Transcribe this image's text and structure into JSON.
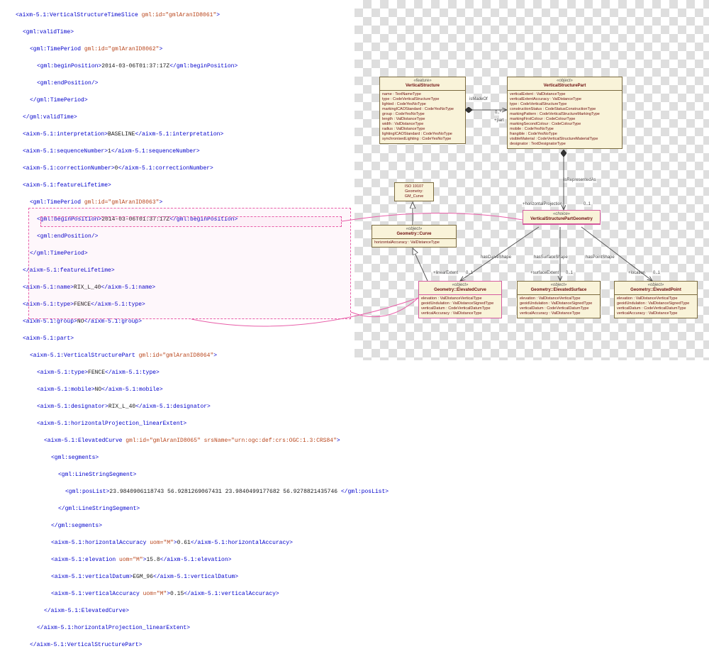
{
  "xml": {
    "l0": "<aixm-5.1:VerticalStructureTimeSlice ",
    "l0_attr": "gml:id=\"gmlAranID8061\"",
    "l0_end": ">",
    "l1": "<gml:validTime>",
    "l2": "<gml:TimePeriod ",
    "l2_attr": "gml:id=\"gmlAranID8062\"",
    "l2_end": ">",
    "l3": "<gml:beginPosition>",
    "l3_txt": "2014-03-06T01:37:17Z",
    "l3_end": "</gml:beginPosition>",
    "l4": "<gml:endPosition/>",
    "l5": "</gml:TimePeriod>",
    "l6": "</gml:validTime>",
    "l7": "<aixm-5.1:interpretation>",
    "l7_txt": "BASELINE",
    "l7_end": "</aixm-5.1:interpretation>",
    "l8": "<aixm-5.1:sequenceNumber>",
    "l8_txt": "1",
    "l8_end": "</aixm-5.1:sequenceNumber>",
    "l9": "<aixm-5.1:correctionNumber>",
    "l9_txt": "0",
    "l9_end": "</aixm-5.1:correctionNumber>",
    "l10": "<aixm-5.1:featureLifetime>",
    "l11": "<gml:TimePeriod ",
    "l11_attr": "gml:id=\"gmlAranID8063\"",
    "l11_end": ">",
    "l12": "<gml:beginPosition>",
    "l12_txt": "2014-03-06T01:37:17Z",
    "l12_end": "</gml:beginPosition>",
    "l13": "<gml:endPosition/>",
    "l14": "</gml:TimePeriod>",
    "l15": "</aixm-5.1:featureLifetime>",
    "l16": "<aixm-5.1:name>",
    "l16_txt": "RIX_L_40",
    "l16_end": "</aixm-5.1:name>",
    "l17": "<aixm-5.1:type>",
    "l17_txt": "FENCE",
    "l17_end": "</aixm-5.1:type>",
    "l18": "<aixm-5.1:group>",
    "l18_txt": "NO",
    "l18_end": "</aixm-5.1:group>",
    "l19": "<aixm-5.1:part>",
    "l20": "<aixm-5.1:VerticalStructurePart ",
    "l20_attr": "gml:id=\"gmlAranID8064\"",
    "l20_end": ">",
    "l21": "<aixm-5.1:type>",
    "l21_txt": "FENCE",
    "l21_end": "</aixm-5.1:type>",
    "l22": "<aixm-5.1:mobile>",
    "l22_txt": "NO",
    "l22_end": "</aixm-5.1:mobile>",
    "l23": "<aixm-5.1:designator>",
    "l23_txt": "RIX_L_40",
    "l23_end": "</aixm-5.1:designator>",
    "l24": "<aixm-5.1:horizontalProjection_linearExtent>",
    "l25": "<aixm-5.1:ElevatedCurve ",
    "l25_attr1": "gml:id=\"gmlAranID8065\"",
    "l25_attr2": " srsName=\"urn:ogc:def:crs:OGC:1.3:CRS84\"",
    "l25_end": ">",
    "l26": "<gml:segments>",
    "l27": "<gml:LineStringSegment>",
    "l28": "<gml:posList>",
    "l28_txt": "23.9840906118743 56.9281269067431 23.9840499177682 56.9278821435746 ",
    "l28_end": "</gml:posList>",
    "l29": "</gml:LineStringSegment>",
    "l30": "</gml:segments>",
    "l31": "<aixm-5.1:horizontalAccuracy ",
    "l31_attr": "uom=\"M\"",
    "l31_mid": ">",
    "l31_txt": "0.61",
    "l31_end": "</aixm-5.1:horizontalAccuracy>",
    "l32": "<aixm-5.1:elevation ",
    "l32_attr": "uom=\"M\"",
    "l32_mid": ">",
    "l32_txt": "15.8",
    "l32_end": "</aixm-5.1:elevation>",
    "l33": "<aixm-5.1:verticalDatum>",
    "l33_txt": "EGM_96",
    "l33_end": "</aixm-5.1:verticalDatum>",
    "l34": "<aixm-5.1:verticalAccuracy ",
    "l34_attr": "uom=\"M\"",
    "l34_mid": ">",
    "l34_txt": "0.15",
    "l34_end": "</aixm-5.1:verticalAccuracy>",
    "l35": "</aixm-5.1:ElevatedCurve>",
    "l36": "</aixm-5.1:horizontalProjection_linearExtent>",
    "l37": "</aixm-5.1:VerticalStructurePart>"
  },
  "uml": {
    "vs": {
      "stereo": "«feature»",
      "title": "VerticalStructure",
      "attrs": [
        "name : TextNameType",
        "type : CodeVerticalStructureType",
        "lighted : CodeYesNoType",
        "markingICAOStandard : CodeYesNoType",
        "group : CodeYesNoType",
        "length : ValDistanceType",
        "width : ValDistanceType",
        "radius : ValDistanceType",
        "lightingICAOStandard : CodeYesNoType",
        "synchronisedLighting : CodeYesNoType"
      ]
    },
    "vsp": {
      "stereo": "«object»",
      "title": "VerticalStructurePart",
      "attrs": [
        "verticalExtent : ValDistanceType",
        "verticalExtentAccuracy : ValDistanceType",
        "type : CodeVerticalStructureType",
        "constructionStatus : CodeStatusConstructionType",
        "markingPattern : CodeVerticalStructureMarkingType",
        "markingFirstColour : CodeColourType",
        "markingSecondColour : CodeColourType",
        "mobile : CodeYesNoType",
        "frangible : CodeYesNoType",
        "visibleMaterial : CodeVerticalStructureMaterialType",
        "designator : TextDesignatorType"
      ]
    },
    "iso": {
      "title": "ISO 19107 Geometry: GM_Curve"
    },
    "gcurve": {
      "stereo": "«object»",
      "title": "Geometry::Curve",
      "attrs": [
        "horizontalAccuracy : ValDistanceType"
      ]
    },
    "vspg": {
      "stereo": "«choice»",
      "title": "VerticalStructurePartGeometry"
    },
    "ecurve": {
      "stereo": "«object»",
      "title": "Geometry::ElevatedCurve",
      "attrs": [
        "elevation : ValDistanceVerticalType",
        "geoidUndulation : ValDistanceSignedType",
        "verticalDatum : CodeVerticalDatumType",
        "verticalAccuracy : ValDistanceType"
      ]
    },
    "esurf": {
      "stereo": "«object»",
      "title": "Geometry::ElevatedSurface",
      "attrs": [
        "elevation : ValDistanceVerticalType",
        "geoidUndulation : ValDistanceSignedType",
        "verticalDatum : CodeVerticalDatumType",
        "verticalAccuracy : ValDistanceType"
      ]
    },
    "epoint": {
      "stereo": "«object»",
      "title": "Geometry::ElevatedPoint",
      "attrs": [
        "elevation : ValDistanceVerticalType",
        "geoidUndulation : ValDistanceSignedType",
        "verticalDatum : CodeVerticalDatumType",
        "verticalAccuracy : ValDistanceType"
      ]
    }
  },
  "lbl": {
    "isMadeOf": "isMadeOf",
    "part": "+part",
    "oneStar": "0..*",
    "horizProj": "+horizontalProjection",
    "zeroOne": "0..1",
    "isRepr": "isRepresentedAs",
    "linExt": "+linearExtent",
    "surfExt": "+surfaceExtent",
    "loc": "+location",
    "hasCurve": "hasCurveShape",
    "hasSurf": "hasSurfaceShape",
    "hasPoint": "hasPointShape"
  }
}
